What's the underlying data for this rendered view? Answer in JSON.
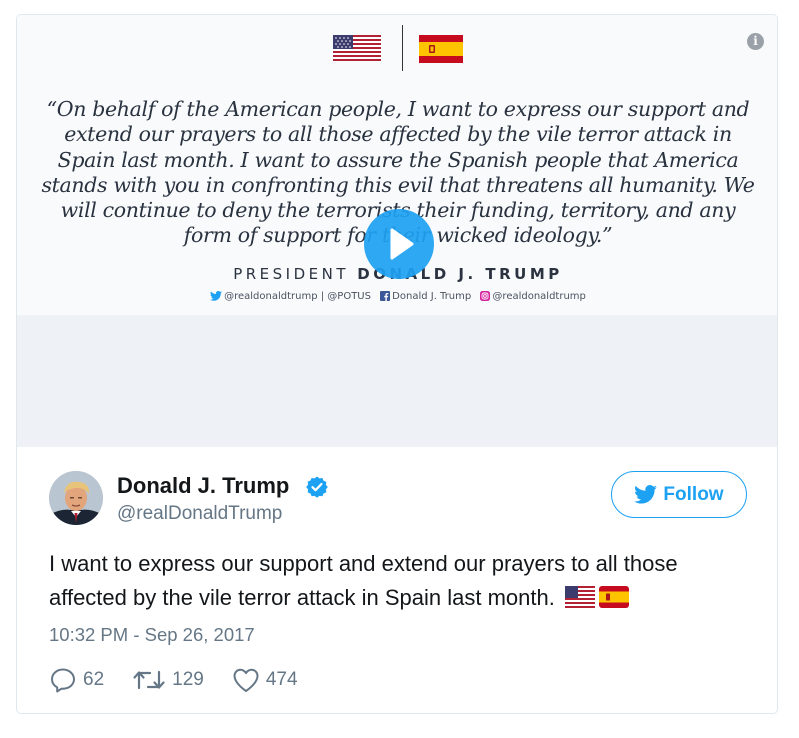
{
  "media": {
    "quote": "“On behalf of the American people, I want to express our support and extend our prayers to all those affected by the vile terror attack in Spain last month. I want to assure the Spanish people that America stands with you in confronting this evil that threatens all humanity. We will continue to deny the terrorists their funding, territory, and any form of support for their wicked ideology.”",
    "attribution_prefix": "PRESIDENT ",
    "attribution_name": "DONALD J. TRUMP",
    "socials": {
      "twitter": "@realdonaldtrump | @POTUS",
      "facebook": "Donald J. Trump",
      "instagram": "@realdonaldtrump"
    },
    "info_glyph": "i",
    "icons": [
      "us-flag-icon",
      "spain-flag-icon",
      "info-icon",
      "play-icon"
    ]
  },
  "tweet": {
    "display_name": "Donald J. Trump",
    "username": "@realDonaldTrump",
    "follow_label": "Follow",
    "text": "I want to express our support and extend our prayers to all those affected by the vile terror attack in Spain last month.",
    "timestamp": "10:32 PM - Sep 26, 2017",
    "counts": {
      "replies": "62",
      "retweets": "129",
      "likes": "474"
    }
  },
  "colors": {
    "accent": "#1da1f2",
    "muted": "#657786",
    "text": "#14171a",
    "border": "#e1e8ed"
  }
}
